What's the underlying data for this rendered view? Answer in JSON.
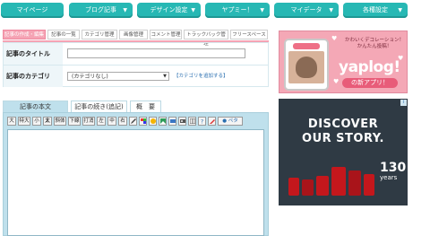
{
  "nav": [
    {
      "label": "マイページ",
      "has_arrow": false
    },
    {
      "label": "ブログ記事",
      "has_arrow": true
    },
    {
      "label": "デザイン設定",
      "has_arrow": true
    },
    {
      "label": "ヤプミー！",
      "has_arrow": true
    },
    {
      "label": "マイデータ",
      "has_arrow": true
    },
    {
      "label": "各種設定",
      "has_arrow": true
    }
  ],
  "subtabs": [
    {
      "label": "記事の作成・編集",
      "active": true
    },
    {
      "label": "記事の一覧",
      "active": false
    },
    {
      "label": "カテゴリ管理",
      "active": false
    },
    {
      "label": "画像管理",
      "active": false
    },
    {
      "label": "コメント管理",
      "active": false
    },
    {
      "label": "トラックバック管理",
      "active": false
    },
    {
      "label": "フリースペース",
      "active": false
    }
  ],
  "form": {
    "title_label": "記事のタイトル",
    "title_value": "",
    "category_label": "記事のカテゴリ",
    "category_value": "(カテゴリなし)",
    "add_category_link": "【カテゴリを追加する】"
  },
  "editor_tabs": [
    {
      "label": "記事の本文",
      "active": true
    },
    {
      "label": "記事の続き(追記)",
      "active": false
    },
    {
      "label": "概　要",
      "active": false
    }
  ],
  "toolbar": {
    "text_buttons": [
      "大",
      "特大",
      "小",
      "太",
      "斜体",
      "下線",
      "打消",
      "左",
      "中",
      "右"
    ],
    "icon_buttons": [
      "pencil-icon",
      "color-icon",
      "emoji-icon",
      "image-icon",
      "link-icon",
      "movie-icon",
      "table-icon",
      "help-icon",
      "paint-icon"
    ],
    "pdf_label": "ペタ"
  },
  "body_text": "",
  "ad1": {
    "line1": "かわいくデコレーション！",
    "line2": "かんたん投稿！",
    "logo": "yaplog!",
    "badge": "の新アプリ！"
  },
  "ad2": {
    "headline1": "DISCOVER",
    "headline2": "OUR STORY.",
    "years_number": "130",
    "years_label": "years",
    "ad_marker": "i"
  },
  "colors": {
    "nav": "#27b8b4",
    "active_subtab": "#f5a3b4",
    "editor_bg": "#bfe0ec",
    "ad1_bg": "#f4a8b6",
    "ad2_bg": "#2f3a44",
    "bag_red": "#c4171c"
  }
}
